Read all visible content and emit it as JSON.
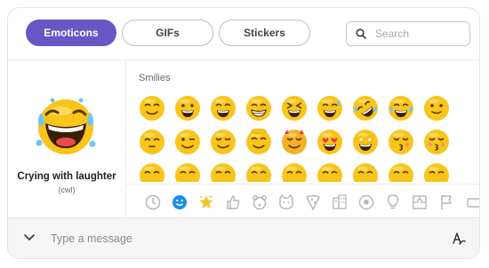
{
  "tabs": [
    {
      "label": "Emoticons",
      "active": true
    },
    {
      "label": "GIFs",
      "active": false
    },
    {
      "label": "Stickers",
      "active": false
    }
  ],
  "search": {
    "placeholder": "Search",
    "icon": "search-icon"
  },
  "preview": {
    "title": "Crying with laughter",
    "code": "(cwl)",
    "icon": "crying-with-laughter-emoji"
  },
  "grid": {
    "section_label": "Smilies",
    "emoticons": [
      "smile",
      "big-smile",
      "grin",
      "laugh",
      "squint-laugh",
      "sweat-smile",
      "rofl",
      "crying-with-laughter",
      "slight-smile",
      "sleepy",
      "wink",
      "happy",
      "angel",
      "devil",
      "heart-eyes",
      "star-struck",
      "kiss",
      "kissing-closed-eyes",
      "partial-1",
      "partial-2",
      "partial-3",
      "partial-4",
      "partial-5",
      "partial-6",
      "partial-7",
      "partial-8",
      "partial-9"
    ]
  },
  "categories": [
    "clock-icon",
    "smiley-icon",
    "star-icon",
    "thumbs-up-icon",
    "bear-icon",
    "cat-face-icon",
    "pizza-icon",
    "building-icon",
    "soccer-ball-icon",
    "lightbulb-icon",
    "puzzle-icon",
    "flag-icon",
    "rectangle-icon"
  ],
  "composer": {
    "placeholder": "Type a message",
    "expand_icon": "chevron-down-icon",
    "format_icon": "text-format-icon"
  },
  "colors": {
    "accent": "#6a55c4",
    "emoji_yellow": "#f9c51b",
    "category_active": "#1a8fe3"
  }
}
